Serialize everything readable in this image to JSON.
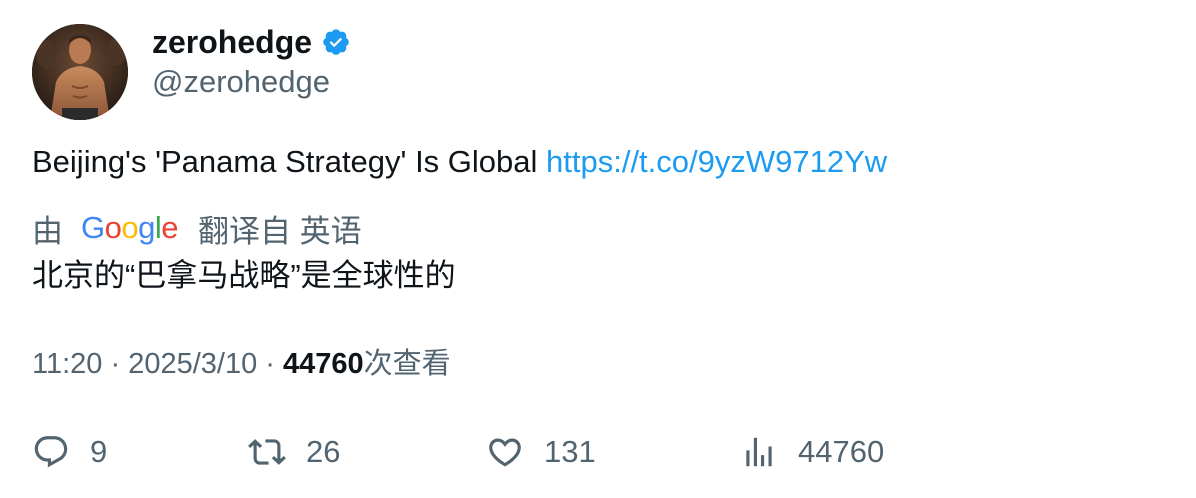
{
  "author": {
    "display_name": "zerohedge",
    "handle": "@zerohedge",
    "verified": true,
    "verified_color": "#1d9bf0"
  },
  "tweet": {
    "text": "Beijing's 'Panama Strategy' Is Global ",
    "link": "https://t.co/9yzW9712Yw"
  },
  "translation": {
    "prefix": "由",
    "provider": "Google",
    "suffix": "翻译自 英语",
    "text": "北京的“巴拿马战略”是全球性的"
  },
  "meta": {
    "time": "11:20",
    "separator": " · ",
    "date": "2025/3/10",
    "views_count": "44760",
    "views_label": "次查看"
  },
  "actions": {
    "replies": "9",
    "retweets": "26",
    "likes": "131",
    "views": "44760"
  },
  "colors": {
    "link": "#1d9bf0",
    "secondary_text": "#536471",
    "primary_text": "#0f1419",
    "google_blue": "#4285f4",
    "google_red": "#ea4335",
    "google_yellow": "#fbbc05",
    "google_green": "#34a853"
  }
}
